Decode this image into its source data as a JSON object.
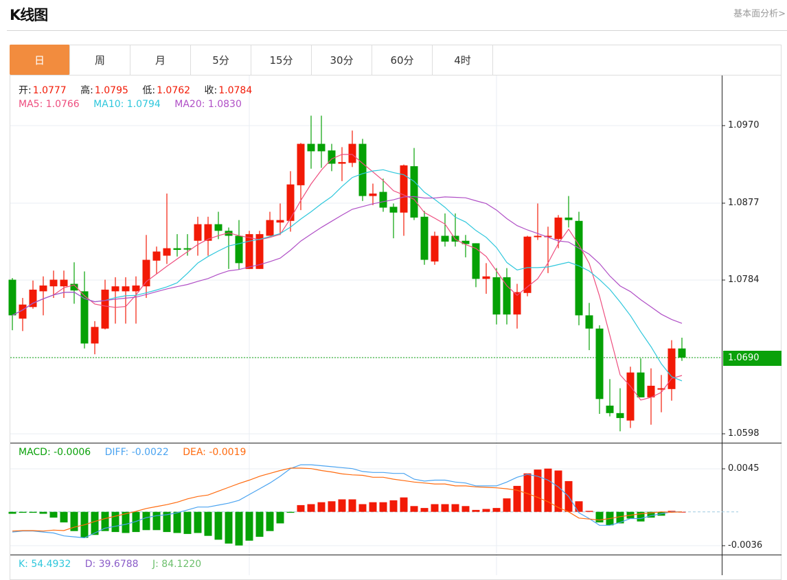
{
  "header": {
    "title": "K线图",
    "fundamental_link": "基本面分析>"
  },
  "tabs": [
    {
      "label": "日",
      "active": true
    },
    {
      "label": "周"
    },
    {
      "label": "月"
    },
    {
      "label": "5分"
    },
    {
      "label": "15分"
    },
    {
      "label": "30分"
    },
    {
      "label": "60分"
    },
    {
      "label": "4时"
    }
  ],
  "ohlc_legend": {
    "open_label": "开:",
    "open": "1.0777",
    "high_label": "高:",
    "high": "1.0795",
    "low_label": "低:",
    "low": "1.0762",
    "close_label": "收:",
    "close": "1.0784"
  },
  "ma_legend": {
    "ma5": "MA5: 1.0766",
    "ma10": "MA10: 1.0794",
    "ma20": "MA20: 1.0830"
  },
  "macd_legend": {
    "macd": "MACD: -0.0006",
    "diff": "DIFF: -0.0022",
    "dea": "DEA: -0.0019"
  },
  "kdj_legend": {
    "k": "K: 54.4932",
    "d": "D: 39.6788",
    "j": "J: 84.1220"
  },
  "colors": {
    "up": "#f21a06",
    "down": "#05a105",
    "ma5": "#ee4d7e",
    "ma10": "#2ec7dc",
    "ma20": "#b04fc6",
    "diff": "#4aa3f0",
    "dea": "#ff6a0e",
    "accent": "#f28c3e"
  },
  "chart_data": {
    "type": "candlestick",
    "price_axis": {
      "ticks": [
        "1.0970",
        "1.0877",
        "1.0784",
        "1.0598"
      ],
      "range": [
        1.0598,
        1.097
      ]
    },
    "current_price": "1.0690",
    "candles": [
      [
        1.0784,
        1.0786,
        1.0723,
        1.0741
      ],
      [
        1.0737,
        1.0762,
        1.0722,
        1.0754
      ],
      [
        1.0751,
        1.0783,
        1.0749,
        1.0772
      ],
      [
        1.077,
        1.0788,
        1.0741,
        1.0777
      ],
      [
        1.0776,
        1.0795,
        1.0762,
        1.0784
      ],
      [
        1.0776,
        1.0795,
        1.0762,
        1.0784
      ],
      [
        1.0779,
        1.0805,
        1.0755,
        1.0771
      ],
      [
        1.077,
        1.0794,
        1.0701,
        1.0707
      ],
      [
        1.0707,
        1.0734,
        1.0694,
        1.0727
      ],
      [
        1.0725,
        1.0784,
        1.0724,
        1.0772
      ],
      [
        1.077,
        1.0787,
        1.0731,
        1.0776
      ],
      [
        1.077,
        1.0787,
        1.0731,
        1.0776
      ],
      [
        1.077,
        1.0788,
        1.0731,
        1.0777
      ],
      [
        1.0776,
        1.0838,
        1.0762,
        1.0808
      ],
      [
        1.0807,
        1.0824,
        1.0791,
        1.0818
      ],
      [
        1.0813,
        1.0888,
        1.0803,
        1.0822
      ],
      [
        1.0822,
        1.0839,
        1.0812,
        1.082
      ],
      [
        1.0822,
        1.0839,
        1.0813,
        1.0821
      ],
      [
        1.0831,
        1.086,
        1.0813,
        1.0851
      ],
      [
        1.0831,
        1.086,
        1.0813,
        1.0851
      ],
      [
        1.0851,
        1.0866,
        1.0833,
        1.0843
      ],
      [
        1.0843,
        1.0847,
        1.0797,
        1.0837
      ],
      [
        1.0837,
        1.0856,
        1.0796,
        1.0804
      ],
      [
        1.0797,
        1.0843,
        1.0797,
        1.0839
      ],
      [
        1.0797,
        1.0843,
        1.0797,
        1.0839
      ],
      [
        1.0837,
        1.0866,
        1.0837,
        1.0856
      ],
      [
        1.0853,
        1.0876,
        1.0838,
        1.0856
      ],
      [
        1.0855,
        1.0915,
        1.0842,
        1.0899
      ],
      [
        1.0898,
        1.0949,
        1.0868,
        1.0948
      ],
      [
        1.0948,
        1.0982,
        1.0918,
        1.0939
      ],
      [
        1.0948,
        1.0982,
        1.0919,
        1.0939
      ],
      [
        1.094,
        1.0948,
        1.0915,
        1.0924
      ],
      [
        1.0924,
        1.0944,
        1.0903,
        1.0926
      ],
      [
        1.0925,
        1.0964,
        1.092,
        1.0948
      ],
      [
        1.0948,
        1.0954,
        1.0879,
        1.0885
      ],
      [
        1.0885,
        1.09,
        1.0874,
        1.0888
      ],
      [
        1.089,
        1.0906,
        1.0866,
        1.0871
      ],
      [
        1.0872,
        1.0876,
        1.0834,
        1.0865
      ],
      [
        1.0865,
        1.0923,
        1.0837,
        1.0922
      ],
      [
        1.0921,
        1.0943,
        1.0856,
        1.0859
      ],
      [
        1.086,
        1.0867,
        1.0802,
        1.0808
      ],
      [
        1.0806,
        1.0842,
        1.0802,
        1.0837
      ],
      [
        1.0837,
        1.0864,
        1.0824,
        1.083
      ],
      [
        1.0837,
        1.0864,
        1.0824,
        1.083
      ],
      [
        1.0831,
        1.0838,
        1.0811,
        1.0827
      ],
      [
        1.0828,
        1.0828,
        1.0775,
        1.0785
      ],
      [
        1.0785,
        1.0804,
        1.0767,
        1.0788
      ],
      [
        1.0787,
        1.0798,
        1.073,
        1.0742
      ],
      [
        1.0787,
        1.0798,
        1.073,
        1.0742
      ],
      [
        1.0742,
        1.0779,
        1.0725,
        1.0769
      ],
      [
        1.0768,
        1.0837,
        1.0764,
        1.0836
      ],
      [
        1.0836,
        1.0876,
        1.0832,
        1.0837
      ],
      [
        1.0836,
        1.0848,
        1.0792,
        1.0837
      ],
      [
        1.0833,
        1.0862,
        1.0822,
        1.0859
      ],
      [
        1.0859,
        1.0885,
        1.0847,
        1.0856
      ],
      [
        1.0855,
        1.0866,
        1.0729,
        1.0741
      ],
      [
        1.0741,
        1.0756,
        1.0699,
        1.0725
      ],
      [
        1.0725,
        1.0729,
        1.0622,
        1.064
      ],
      [
        1.0632,
        1.0664,
        1.0619,
        1.0623
      ],
      [
        1.0623,
        1.0653,
        1.0601,
        1.0617
      ],
      [
        1.0614,
        1.0679,
        1.0605,
        1.0672
      ],
      [
        1.0672,
        1.0689,
        1.0642,
        1.0642
      ],
      [
        1.0642,
        1.0677,
        1.0609,
        1.0656
      ],
      [
        1.0652,
        1.0669,
        1.0624,
        1.0653
      ],
      [
        1.0652,
        1.0711,
        1.0638,
        1.0701
      ],
      [
        1.0701,
        1.0714,
        1.0686,
        1.069
      ]
    ],
    "macd_axis": {
      "ticks": [
        "0.0045",
        "-0.0036"
      ],
      "range": [
        -0.0036,
        0.0045
      ]
    },
    "macd": [
      -0.0002,
      -0.0001,
      -0.0001,
      -0.0002,
      -0.0006,
      -0.0011,
      -0.002,
      -0.0027,
      -0.0024,
      -0.002,
      -0.0021,
      -0.0022,
      -0.0021,
      -0.0019,
      -0.0019,
      -0.0021,
      -0.0022,
      -0.0023,
      -0.0022,
      -0.0025,
      -0.0029,
      -0.0033,
      -0.0035,
      -0.003,
      -0.0026,
      -0.002,
      -0.0012,
      -0.0001,
      0.0007,
      0.0008,
      0.001,
      0.0011,
      0.0013,
      0.0013,
      0.0008,
      0.001,
      0.001,
      0.0012,
      0.0015,
      0.0006,
      0.0004,
      0.0008,
      0.0008,
      0.0008,
      0.0006,
      0.0002,
      0.0003,
      0.0004,
      0.0014,
      0.0027,
      0.004,
      0.0044,
      0.0045,
      0.0043,
      0.0032,
      0.0011,
      0.0001,
      -0.0011,
      -0.0014,
      -0.0012,
      -0.0007,
      -0.001,
      -0.0006,
      -0.0004,
      0.0001,
      0.0
    ],
    "diff": [
      -0.0021,
      -0.002,
      -0.002,
      -0.0021,
      -0.0022,
      -0.0025,
      -0.0026,
      -0.0027,
      -0.0022,
      -0.0017,
      -0.0015,
      -0.0013,
      -0.001,
      -0.0006,
      -0.0004,
      -0.0003,
      -0.0001,
      0.0002,
      0.0005,
      0.0005,
      0.0007,
      0.0009,
      0.0012,
      0.0018,
      0.0024,
      0.003,
      0.0037,
      0.0045,
      0.0049,
      0.0049,
      0.0048,
      0.0047,
      0.0046,
      0.0045,
      0.0042,
      0.0041,
      0.0041,
      0.004,
      0.004,
      0.0034,
      0.0032,
      0.0033,
      0.0033,
      0.0031,
      0.003,
      0.0027,
      0.0027,
      0.0027,
      0.0031,
      0.0036,
      0.0039,
      0.0037,
      0.0033,
      0.0026,
      0.0016,
      -0.0001,
      -0.0007,
      -0.0014,
      -0.0014,
      -0.0011,
      -0.0007,
      -0.0007,
      -0.0004,
      -0.0002,
      0.0,
      0.0
    ]
  }
}
